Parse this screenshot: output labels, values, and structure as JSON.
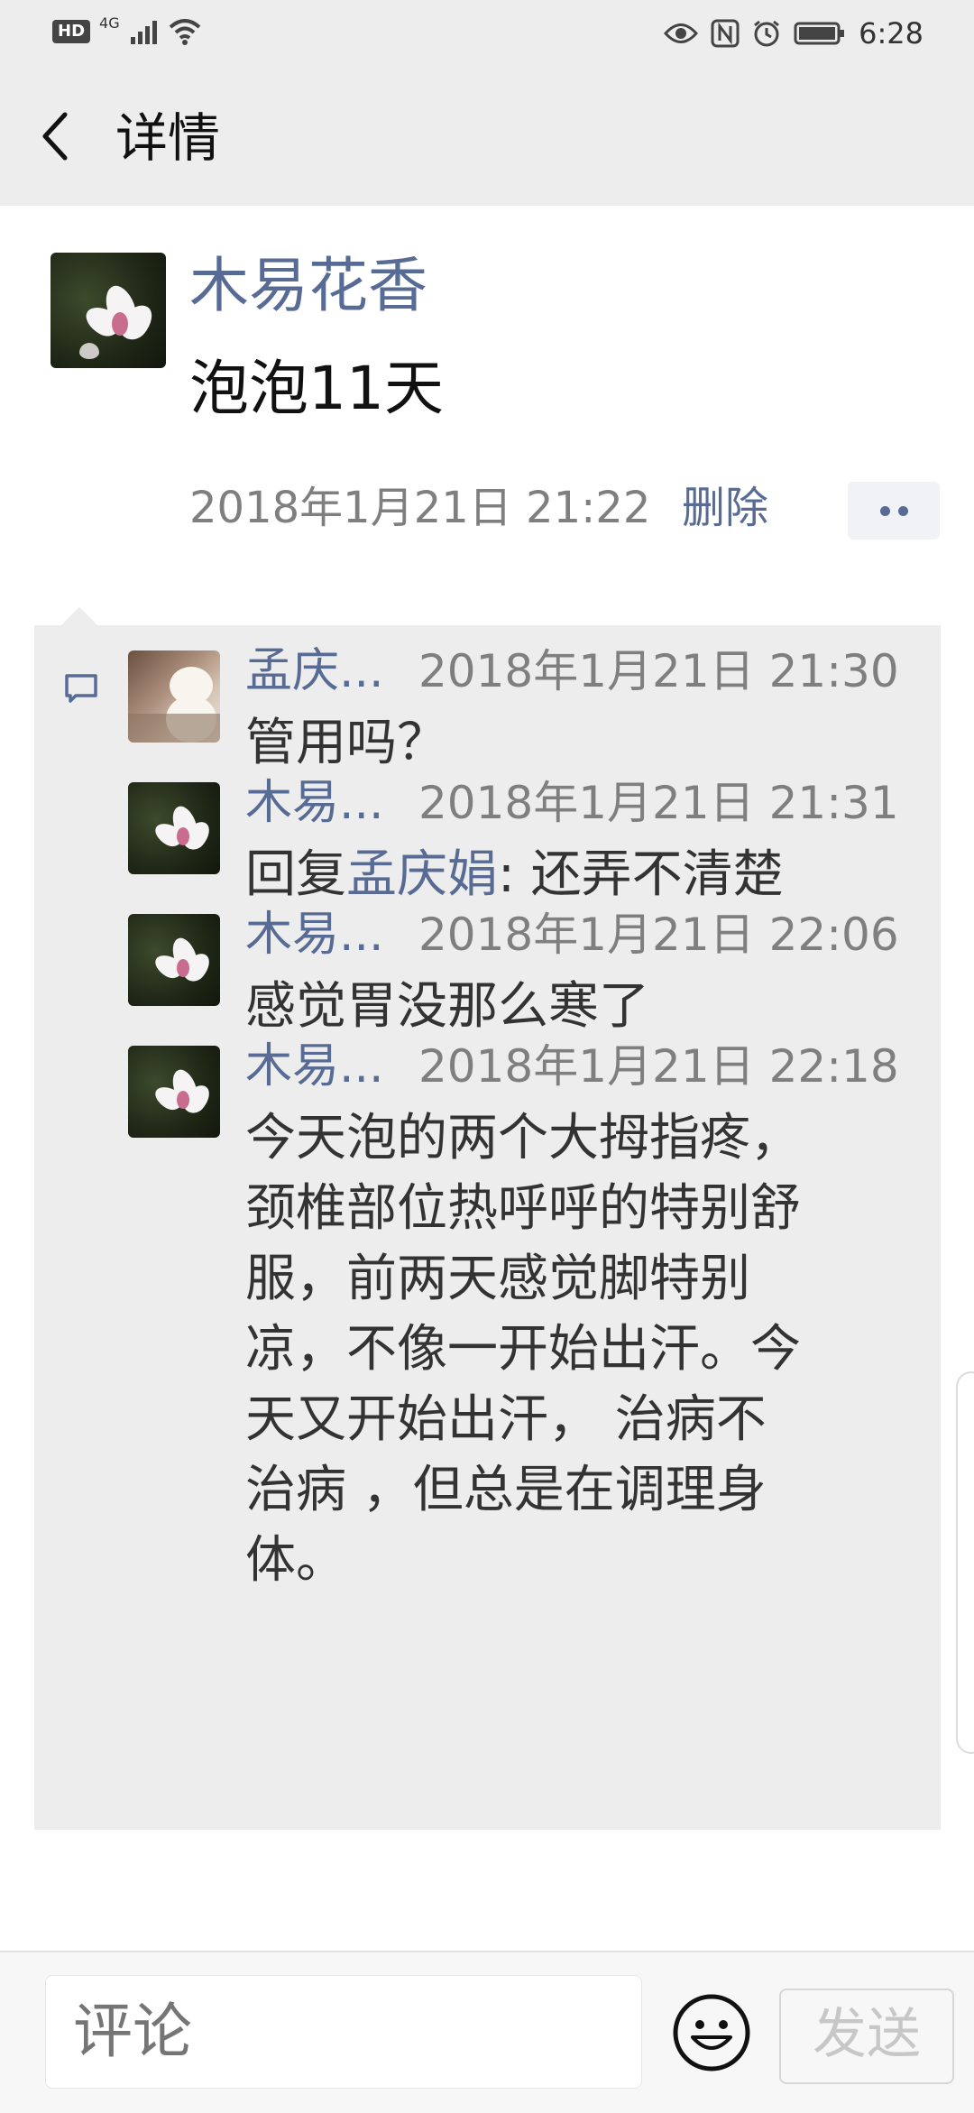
{
  "status_bar": {
    "hd_label": "HD",
    "network_label": "4G",
    "time": "6:28",
    "icons": [
      "signal-icon",
      "wifi-icon",
      "eye-icon",
      "nfc-icon",
      "alarm-icon",
      "battery-icon"
    ]
  },
  "header": {
    "back_icon": "chevron-left-icon",
    "title": "详情"
  },
  "post": {
    "author": "木易花香",
    "text": "泡泡11天",
    "timestamp": "2018年1月21日 21:22",
    "delete_label": "删除",
    "more_icon": "more-dots-icon"
  },
  "comments": [
    {
      "author": "孟庆...",
      "time": "2018年1月21日 21:30",
      "text": "管用吗？",
      "avatar": "cat-avatar"
    },
    {
      "author": "木易...",
      "time": "2018年1月21日 21:31",
      "reply_prefix": "回复",
      "reply_to": "孟庆娟",
      "text": ": 还弄不清楚",
      "avatar": "flower-avatar"
    },
    {
      "author": "木易...",
      "time": "2018年1月21日 22:06",
      "text": "感觉胃没那么寒了",
      "avatar": "flower-avatar"
    },
    {
      "author": "木易...",
      "time": "2018年1月21日 22:18",
      "lines": [
        "今天泡的两个大拇指疼，",
        "颈椎部位热呼呼的特别舒",
        "服，前两天感觉脚特别",
        "凉，不像一开始出汗。今",
        "天又开始出汗， 治病不",
        "治病 ，但总是在调理身",
        "体。"
      ],
      "avatar": "flower-avatar"
    }
  ],
  "input_bar": {
    "placeholder": "评论",
    "emoji_icon": "smiley-icon",
    "send_label": "发送"
  },
  "colors": {
    "link_blue": "#576b95",
    "header_bg": "#ededed",
    "comment_bg": "#ededed"
  }
}
